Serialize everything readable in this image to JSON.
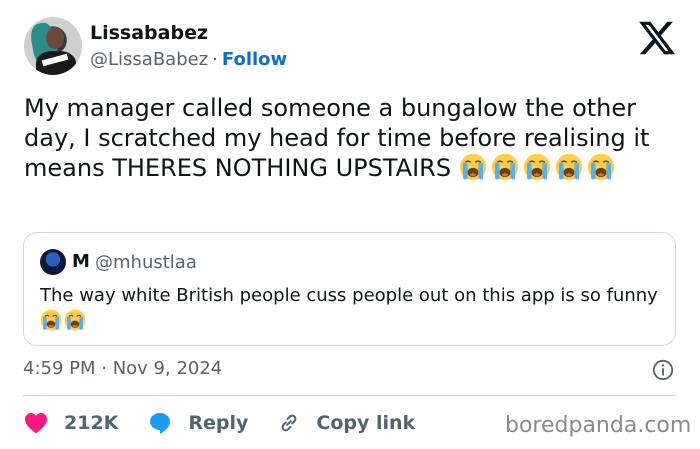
{
  "author": {
    "name": "Lissababez",
    "handle": "@LissaBabez",
    "separator": "·",
    "follow_label": "Follow"
  },
  "tweet": {
    "text": "My manager called someone a bungalow the other day, I scratched my head for time before realising it means THERES NOTHING UPSTAIRS ",
    "emoji_count": 5,
    "emoji_name": "loudly-crying-face"
  },
  "quote": {
    "name": "M",
    "handle": "@mhustlaa",
    "text": "The way white British people cuss people out on this app is so funny",
    "emoji_count": 2
  },
  "timestamp": "4:59 PM · Nov 9, 2024",
  "actions": {
    "likes": "212K",
    "reply_label": "Reply",
    "copy_label": "Copy link"
  },
  "watermark": "boredpanda.com",
  "colors": {
    "follow": "#0f6fc4",
    "like": "#f91880",
    "reply": "#1d9bf0",
    "muted": "#536471"
  }
}
